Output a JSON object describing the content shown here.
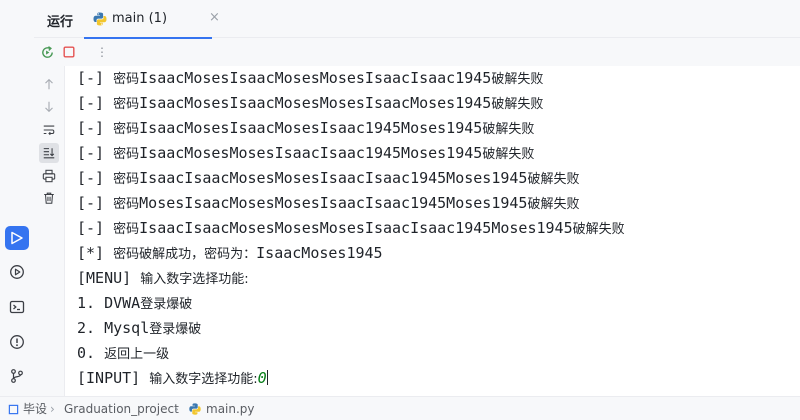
{
  "toolwindow": {
    "run_label": "运行",
    "tab": {
      "label": "main (1)",
      "icon": "python-icon",
      "close": "×"
    }
  },
  "runbar": {
    "rerun": "rerun-icon",
    "stop": "stop-icon",
    "more": "⋮"
  },
  "console": {
    "lines": [
      {
        "prefix": "[-] ",
        "label": "密码",
        "value": "IsaacMosesIsaacMosesMosesIsaacIsaac1945",
        "suffix": "破解失败"
      },
      {
        "prefix": "[-] ",
        "label": "密码",
        "value": "IsaacMosesIsaacMosesMosesIsaacMoses1945",
        "suffix": "破解失败"
      },
      {
        "prefix": "[-] ",
        "label": "密码",
        "value": "IsaacMosesIsaacMosesIsaac1945Moses1945",
        "suffix": "破解失败"
      },
      {
        "prefix": "[-] ",
        "label": "密码",
        "value": "IsaacMosesMosesIsaacIsaac1945Moses1945",
        "suffix": "破解失败"
      },
      {
        "prefix": "[-] ",
        "label": "密码",
        "value": "IsaacIsaacMosesMosesIsaacIsaac1945Moses1945",
        "suffix": "破解失败"
      },
      {
        "prefix": "[-] ",
        "label": "密码",
        "value": "MosesIsaacMosesMosesIsaacIsaac1945Moses1945",
        "suffix": "破解失败"
      },
      {
        "prefix": "[-] ",
        "label": "密码",
        "value": "IsaacIsaacMosesMosesMosesIsaacIsaac1945Moses1945",
        "suffix": "破解失败"
      },
      {
        "prefix": "[*] ",
        "label": "密码破解成功，密码为：",
        "value": "IsaacMoses1945",
        "suffix": ""
      },
      {
        "prefix": "[MENU] ",
        "label": "输入数字选择功能:",
        "value": "",
        "suffix": ""
      },
      {
        "prefix": "1. ",
        "label": "",
        "value": "DVWA",
        "suffix": "登录爆破"
      },
      {
        "prefix": "2. ",
        "label": "",
        "value": "Mysql",
        "suffix": "登录爆破"
      },
      {
        "prefix": "0. ",
        "label": "返回上一级",
        "value": "",
        "suffix": ""
      },
      {
        "prefix": "[INPUT] ",
        "label": "输入数字选择功能:",
        "value": "",
        "suffix": ""
      }
    ],
    "input_value": "0"
  },
  "statusbar": {
    "project": "毕设",
    "folder": "Graduation_project",
    "file": "main.py",
    "chevron": "›"
  },
  "colors": {
    "accent": "#3574f0",
    "input_text": "#067d17",
    "stop": "#e55353",
    "rerun": "#4a9a57"
  }
}
